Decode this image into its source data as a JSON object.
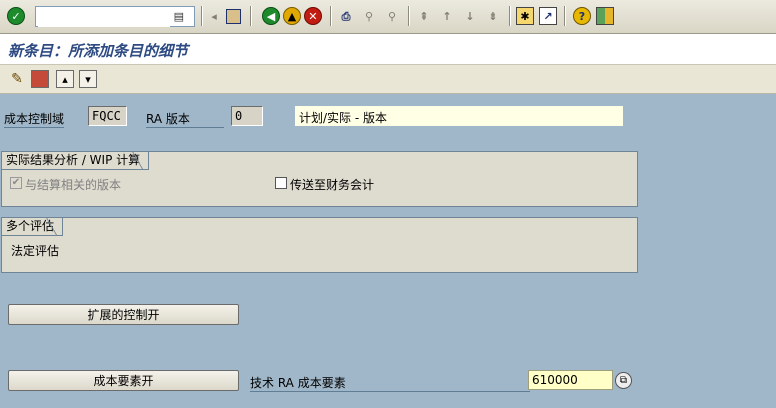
{
  "toolbar": {
    "command_field_value": "",
    "icons": [
      "enter-icon",
      "history-icon",
      "back-arrow-icon",
      "save-icon",
      "back-icon",
      "exit-icon",
      "cancel-icon",
      "print-icon",
      "find-icon",
      "find-next-icon",
      "first-page-icon",
      "previous-page-icon",
      "next-page-icon",
      "last-page-icon",
      "new-session-icon",
      "shortcut-icon",
      "help-icon",
      "layout-icon"
    ]
  },
  "title": "新条目：所添加条目的细节",
  "app_toolbar": {
    "icons": [
      "display-change-icon",
      "save-entry-icon",
      "previous-entry-icon",
      "next-entry-icon"
    ]
  },
  "header": {
    "cost_control_label": "成本控制域",
    "cost_control_value": "FQCC",
    "ra_version_label": "RA 版本",
    "ra_version_value": "0",
    "version_description": "计划/实际 - 版本"
  },
  "group_results": {
    "title": "实际结果分析 / WIP 计算",
    "checkbox1_label": "与结算相关的版本",
    "checkbox1_checked": true,
    "checkbox2_label": "传送至财务会计",
    "checkbox2_checked": false
  },
  "group_valuation": {
    "title": "多个评估",
    "legal_label": "法定评估"
  },
  "buttons": {
    "extended_control": "扩展的控制开",
    "cost_elements": "成本要素开"
  },
  "tech_ra": {
    "label": "技术 RA 成本要素",
    "value": "610000"
  }
}
